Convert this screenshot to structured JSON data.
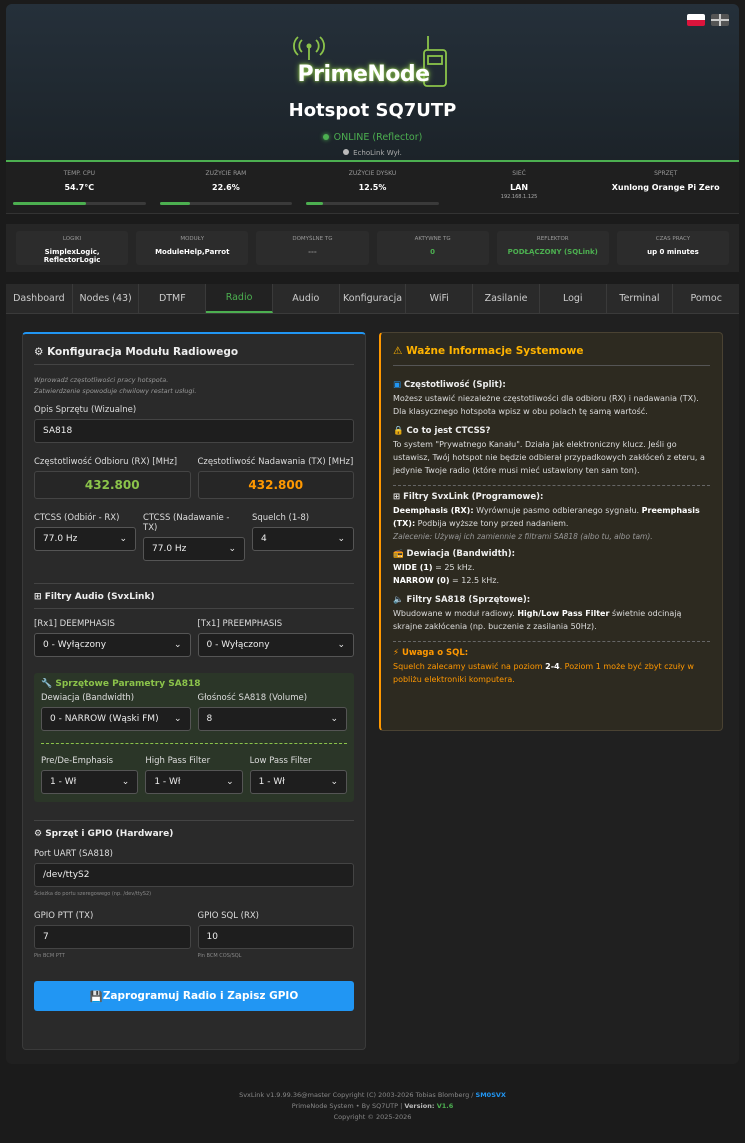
{
  "header": {
    "brand": "PrimeNode",
    "title": "Hotspot SQ7UTP",
    "status": "ONLINE (Reflector)",
    "echolink": "EchoLink Wył."
  },
  "stats": [
    {
      "label": "TEMP. CPU",
      "value": "54.7°C",
      "bar": 0.55
    },
    {
      "label": "ZUŻYCIE RAM",
      "value": "22.6%",
      "bar": 0.226
    },
    {
      "label": "ZUŻYCIE DYSKU",
      "value": "12.5%",
      "bar": 0.125
    },
    {
      "label": "SIEĆ",
      "value": "LAN",
      "sub": "192.168.1.125"
    },
    {
      "label": "SPRZĘT",
      "value": "Xunlong Orange Pi Zero"
    }
  ],
  "info": [
    {
      "label": "LOGIKI",
      "value": "SimplexLogic, ReflectorLogic"
    },
    {
      "label": "MODUŁY",
      "value": "ModuleHelp,Parrot"
    },
    {
      "label": "DOMYŚLNE TG",
      "value": "---"
    },
    {
      "label": "AKTYWNE TG",
      "value": "0"
    },
    {
      "label": "REFLEKTOR",
      "value": "PODŁĄCZONY (SQLink)"
    },
    {
      "label": "CZAS PRACY",
      "value": "up 0 minutes"
    }
  ],
  "tabs": [
    "Dashboard",
    "Nodes (43)",
    "DTMF",
    "Radio",
    "Audio",
    "Konfiguracja",
    "WiFi",
    "Zasilanie",
    "Logi",
    "Terminal",
    "Pomoc"
  ],
  "form": {
    "title": "Konfiguracja Modułu Radiowego",
    "hint1": "Wprowadź częstotliwości pracy hotspota.",
    "hint2": "Zatwierdzenie spowoduje chwilowy restart usługi.",
    "desc_label": "Opis Sprzętu (Wizualne)",
    "desc_value": "SA818",
    "rx_label": "Częstotliwość Odbioru (RX) [MHz]",
    "rx_value": "432.800",
    "tx_label": "Częstotliwość Nadawania (TX) [MHz]",
    "tx_value": "432.800",
    "ctcss_rx_label": "CTCSS (Odbiór - RX)",
    "ctcss_rx_value": "77.0 Hz",
    "ctcss_tx_label": "CTCSS (Nadawanie - TX)",
    "ctcss_tx_value": "77.0 Hz",
    "squelch_label": "Squelch (1-8)",
    "squelch_value": "4",
    "filters_title": "Filtry Audio (SvxLink)",
    "deemph_label": "[Rx1] DEEMPHASIS",
    "deemph_value": "0 - Wyłączony",
    "preemph_label": "[Tx1] PREEMPHASIS",
    "preemph_value": "0 - Wyłączony",
    "sa_title": "Sprzętowe Parametry SA818",
    "dev_label": "Dewiacja (Bandwidth)",
    "dev_value": "0 - NARROW (Wąski FM)",
    "vol_label": "Głośność SA818 (Volume)",
    "vol_value": "8",
    "pre_label": "Pre/De-Emphasis",
    "pre_value": "1 - Wł",
    "hpf_label": "High Pass Filter",
    "hpf_value": "1 - Wł",
    "lpf_label": "Low Pass Filter",
    "lpf_value": "1 - Wł",
    "gpio_title": "Sprzęt i GPIO (Hardware)",
    "uart_label": "Port UART (SA818)",
    "uart_value": "/dev/ttyS2",
    "uart_hint": "Ścieżka do portu szeregowego (np. /dev/ttyS2)",
    "ptt_label": "GPIO PTT (TX)",
    "ptt_value": "7",
    "ptt_hint": "Pin BCM PTT",
    "sql_label": "GPIO SQL (RX)",
    "sql_value": "10",
    "sql_hint": "Pin BCM COS/SQL",
    "submit": "Zaprogramuj Radio i Zapisz GPIO"
  },
  "info_panel": {
    "title": "Ważne Informacje Systemowe",
    "split_h": "Częstotliwość (Split):",
    "split_p": "Możesz ustawić niezależne częstotliwości dla odbioru (RX) i nadawania (TX). Dla klasycznego hotspota wpisz w obu polach tę samą wartość.",
    "ctcss_h": "Co to jest CTCSS?",
    "ctcss_p": "To system \"Prywatnego Kanału\". Działa jak elektroniczny klucz. Jeśli go ustawisz, Twój hotspot nie będzie odbierał przypadkowych zakłóceń z eteru, a jedynie Twoje radio (które musi mieć ustawiony ten sam ton).",
    "svx_h": "Filtry SvxLink (Programowe):",
    "svx_b1": "Deemphasis (RX):",
    "svx_t1": " Wyrównuje pasmo odbieranego sygnału. ",
    "svx_b2": "Preemphasis (TX):",
    "svx_t2": " Podbija wyższe tony przed nadaniem.",
    "svx_i": "Zalecenie: Używaj ich zamiennie z filtrami SA818 (albo tu, albo tam).",
    "dev_h": "Dewiacja (Bandwidth):",
    "dev_b1": "WIDE (1)",
    "dev_t1": " = 25 kHz.",
    "dev_b2": "NARROW (0)",
    "dev_t2": " = 12.5 kHz.",
    "sa_h": "Filtry SA818 (Sprzętowe):",
    "sa_t1": "Wbudowane w moduł radiowy. ",
    "sa_b": "High/Low Pass Filter",
    "sa_t2": " świetnie odcinają skrajne zakłócenia (np. buczenie z zasilania 50Hz).",
    "sql_h": "Uwaga o SQL:",
    "sql_t1": "Squelch zalecamy ustawić na poziom ",
    "sql_b": "2-4",
    "sql_t2": ". Poziom 1 może być zbyt czuły w pobliżu elektroniki komputera."
  },
  "footer": {
    "line1": "SvxLink v1.9.99.36@master Copyright (C) 2003-2026 Tobias Blomberg / ",
    "line1b": "SM0SVX",
    "line2": "PrimeNode System • By SQ7UTP | ",
    "line2b": "Version: ",
    "line2c": "V1.6",
    "line3": "Copyright © 2025-2026"
  },
  "colors": {
    "accent": "#4caf50",
    "primary": "#2196f3",
    "warning": "#ff9800"
  }
}
